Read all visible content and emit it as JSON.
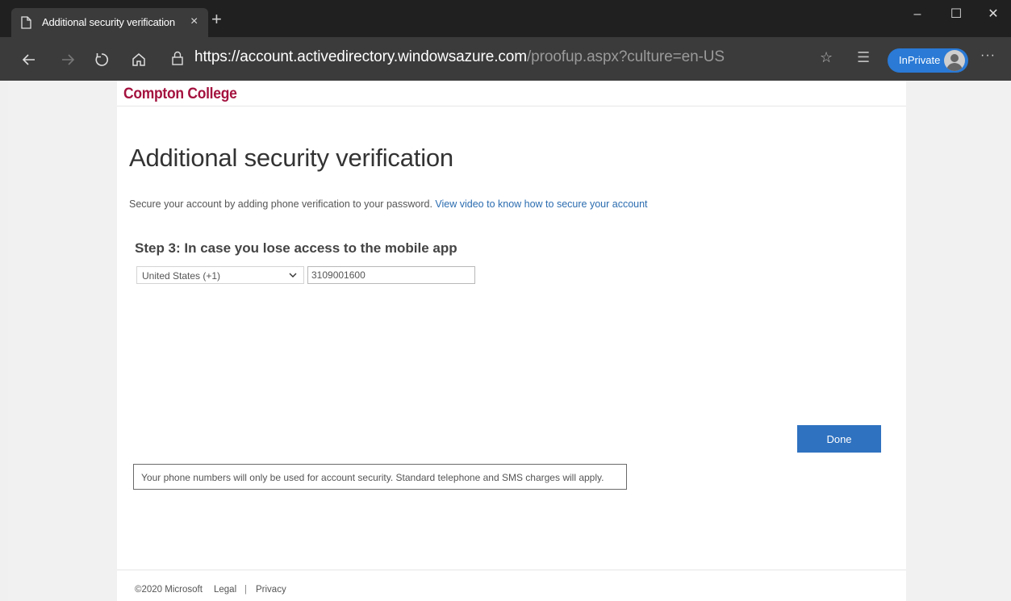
{
  "browser": {
    "tab_title": "Additional security verification",
    "tab_close": "×",
    "new_tab": "+",
    "window_controls": {
      "minimize": "–",
      "maximize": "☐",
      "close": "✕"
    },
    "url_host": "https://account.activedirectory.windowsazure.com",
    "url_path": "/proofup.aspx?culture=en-US",
    "inprivate_label": "InPrivate",
    "more": "···",
    "icons": [
      "back-icon",
      "forward-icon",
      "refresh-icon",
      "home-icon",
      "lock-icon",
      "favorite-star-icon",
      "favorites-list-icon",
      "avatar"
    ]
  },
  "page": {
    "brand": "Compton College",
    "title": "Additional security verification",
    "intro_text": "Secure your account by adding phone verification to your password.",
    "intro_link": "View video to know how to secure your account",
    "step_heading": "Step 3: In case you lose access to the mobile app",
    "country_select": "United States (+1)",
    "phone_value": "3109001600",
    "done_label": "Done",
    "notice": "Your phone numbers will only be used for account security. Standard telephone and SMS charges will apply."
  },
  "footer": {
    "copyright": "©2020 Microsoft",
    "legal": "Legal",
    "separator": "|",
    "privacy": "Privacy"
  },
  "colors": {
    "brand": "#a4123f",
    "accent": "#2f72c0",
    "link": "#2b6cb0",
    "chrome_dark": "#202020",
    "inprivate": "#2a7ad6"
  }
}
